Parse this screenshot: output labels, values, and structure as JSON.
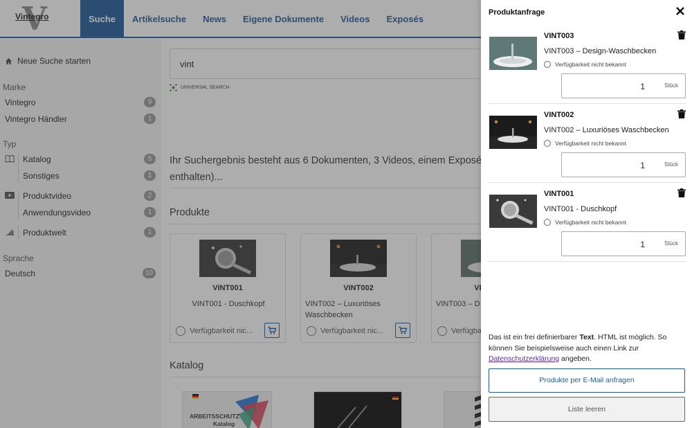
{
  "logo": {
    "text": "Vintegro",
    "mark": "V"
  },
  "nav": [
    "Suche",
    "Artikelsuche",
    "News",
    "Eigene Dokumente",
    "Videos",
    "Exposés"
  ],
  "sidebar": {
    "new_search": "Neue Suche starten",
    "groups": [
      {
        "heading": "Marke",
        "items": [
          {
            "label": "Vintegro",
            "count": "9"
          },
          {
            "label": "Vintegro Händler",
            "count": "1"
          }
        ]
      },
      {
        "heading": "Typ",
        "items": [
          {
            "label": "Katalog",
            "count": "5",
            "icon": "book-icon"
          },
          {
            "label": "Sonstiges",
            "count": "1"
          },
          {
            "label": "Produktvideo",
            "count": "2",
            "icon": "video-icon"
          },
          {
            "label": "Anwendungsvideo",
            "count": "1"
          },
          {
            "label": "Produktwelt",
            "count": "1",
            "icon": "product-world-icon"
          }
        ]
      },
      {
        "heading": "Sprache",
        "items": [
          {
            "label": "Deutsch",
            "count": "10"
          }
        ]
      }
    ]
  },
  "search": {
    "value": "vint",
    "badge": "UNIVERSAL SEARCH"
  },
  "result": {
    "line1": "Ihr Suchergebnis besteht aus 6 Dokumenten, 3 Videos, einem Exposé u",
    "line2": "enthalten)..."
  },
  "products": {
    "heading": "Produkte",
    "availability": "Verfügbarkeit nic...",
    "cards": [
      {
        "code": "VINT001",
        "name": "VINT001 - Duschkopf"
      },
      {
        "code": "VINT002",
        "name": "VINT002 – Luxuriöses Waschbecken"
      },
      {
        "code": "VINT003",
        "name": "VINT003 – D Waschbecken"
      }
    ]
  },
  "catalog": {
    "heading": "Katalog",
    "card1_line1": "ARBEITSSCHUTZ",
    "card1_line2": "Katalog"
  },
  "panel": {
    "title": "Produktanfrage",
    "availability": "Verfügbarkeit nicht bekannt",
    "unit": "Stück",
    "items": [
      {
        "code": "VINT003",
        "name": "VINT003 – Design-Waschbecken",
        "qty": "1"
      },
      {
        "code": "VINT002",
        "name": "VINT002 – Luxuriöses Waschbecken",
        "qty": "1"
      },
      {
        "code": "VINT001",
        "name": "VINT001 - Duschkopf",
        "qty": "1"
      }
    ],
    "text_a": "Das ist ein frei definierbarer ",
    "text_bold": "Text",
    "text_b": ". HTML ist möglich. So können Sie beispielsweise auch einen Link zur ",
    "text_link": "Datenschutzerklärung",
    "text_c": " angeben.",
    "btn_mail": "Produkte per E-Mail anfragen",
    "btn_clear": "Liste leeren"
  },
  "colors": {
    "accent": "#1f5b9a",
    "link": "#5a2aa0",
    "badge": "#9a9a9a"
  }
}
